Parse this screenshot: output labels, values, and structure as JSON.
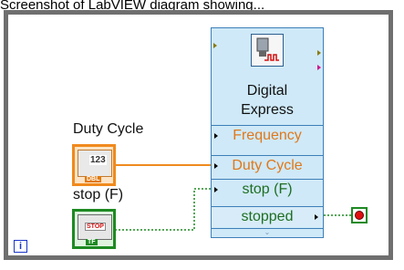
{
  "caption": "Screenshot of LabVIEW diagram showing...",
  "controls": {
    "duty_cycle": {
      "label": "Duty Cycle",
      "display_value": "123",
      "type_tag": "DBL"
    },
    "stop": {
      "label": "stop (F)",
      "button_text": "STOP",
      "type_tag": "TF"
    }
  },
  "express_vi": {
    "title_line1": "Digital",
    "title_line2": "Express",
    "inputs": [
      "Frequency",
      "Duty Cycle",
      "stop (F)"
    ],
    "outputs": [
      "stopped"
    ],
    "grip": "⌄"
  },
  "loop": {
    "iteration_label": "i"
  },
  "colors": {
    "numeric_wire": "#f08a1e",
    "boolean_wire": "#1e8a22",
    "loop_border": "#6f6f6f",
    "express_bg": "#cfe9f8"
  }
}
